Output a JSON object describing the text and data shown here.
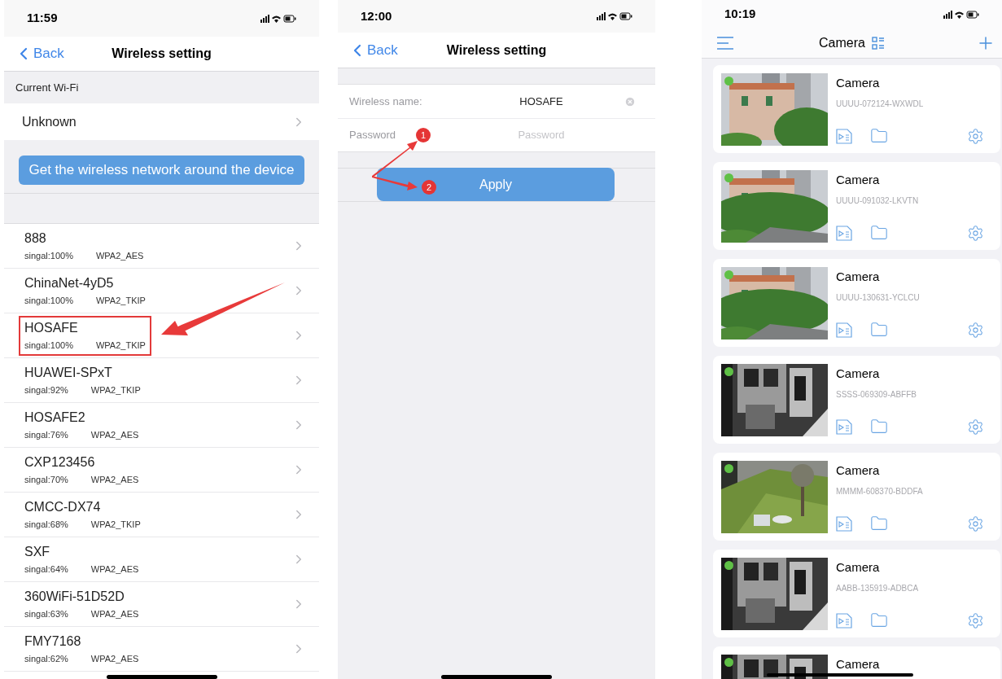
{
  "screens": [
    {
      "kind": "wifi_list",
      "status_bar": {
        "time": "11:59"
      },
      "nav": {
        "back": "Back",
        "title": "Wireless setting"
      },
      "section_header": "Current Wi-Fi",
      "current_wifi": "Unknown",
      "scan_button": "Get the wireless network around the device",
      "networks": [
        {
          "name": "888",
          "signal": "singal:100%",
          "security": "WPA2_AES",
          "highlighted": false
        },
        {
          "name": "ChinaNet-4yD5",
          "signal": "singal:100%",
          "security": "WPA2_TKIP",
          "highlighted": false
        },
        {
          "name": "HOSAFE",
          "signal": "singal:100%",
          "security": "WPA2_TKIP",
          "highlighted": true
        },
        {
          "name": "HUAWEI-SPxT",
          "signal": "singal:92%",
          "security": "WPA2_TKIP",
          "highlighted": false
        },
        {
          "name": "HOSAFE2",
          "signal": "singal:76%",
          "security": "WPA2_AES",
          "highlighted": false
        },
        {
          "name": "CXP123456",
          "signal": "singal:70%",
          "security": "WPA2_AES",
          "highlighted": false
        },
        {
          "name": "CMCC-DX74",
          "signal": "singal:68%",
          "security": "WPA2_TKIP",
          "highlighted": false
        },
        {
          "name": "SXF",
          "signal": "singal:64%",
          "security": "WPA2_AES",
          "highlighted": false
        },
        {
          "name": "360WiFi-51D52D",
          "signal": "singal:63%",
          "security": "WPA2_AES",
          "highlighted": false
        },
        {
          "name": "FMY7168",
          "signal": "singal:62%",
          "security": "WPA2_AES",
          "highlighted": false
        }
      ]
    },
    {
      "kind": "wifi_form",
      "status_bar": {
        "time": "12:00"
      },
      "nav": {
        "back": "Back",
        "title": "Wireless setting"
      },
      "fields": [
        {
          "label": "Wireless name:",
          "value": "HOSAFE",
          "clearable": true
        },
        {
          "label": "Password",
          "placeholder": "Password",
          "clearable": false
        }
      ],
      "apply_button": "Apply",
      "markers": [
        "1",
        "2"
      ]
    },
    {
      "kind": "camera_list",
      "status_bar": {
        "time": "10:19"
      },
      "title": "Camera",
      "cameras": [
        {
          "name": "Camera",
          "uid": "UUUU-072124-WXWDL",
          "online": true
        },
        {
          "name": "Camera",
          "uid": "UUUU-091032-LKVTN",
          "online": true
        },
        {
          "name": "Camera",
          "uid": "UUUU-130631-YCLCU",
          "online": true
        },
        {
          "name": "Camera",
          "uid": "SSSS-069309-ABFFB",
          "online": true
        },
        {
          "name": "Camera",
          "uid": "MMMM-608370-BDDFA",
          "online": true
        },
        {
          "name": "Camera",
          "uid": "AABB-135919-ADBCA",
          "online": true
        },
        {
          "name": "Camera",
          "online": true
        }
      ]
    }
  ]
}
